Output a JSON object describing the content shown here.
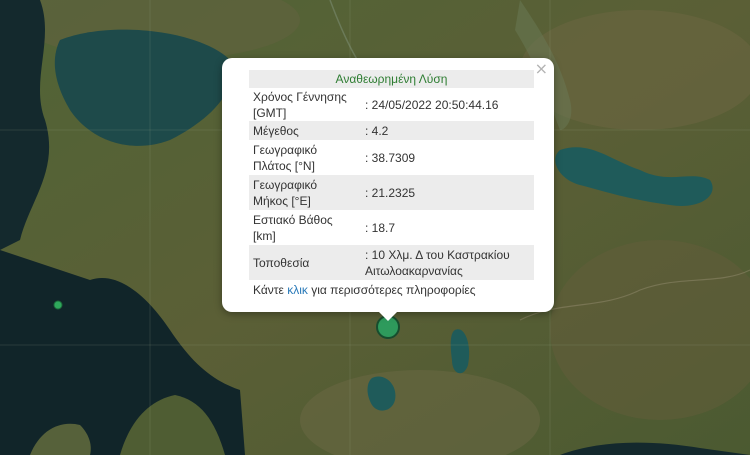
{
  "popup": {
    "title": "Αναθεωρημένη Λύση",
    "close_symbol": "×",
    "rows": [
      {
        "label": "Χρόνος Γέννησης [GMT]",
        "value": ": 24/05/2022 20:50:44.16"
      },
      {
        "label": "Μέγεθος",
        "value": ": 4.2"
      },
      {
        "label": "Γεωγραφικό Πλάτος [°N]",
        "value": ": 38.7309"
      },
      {
        "label": "Γεωγραφικό Μήκος [°E]",
        "value": ": 21.2325"
      },
      {
        "label": "Εστιακό Βάθος [km]",
        "value": ": 18.7"
      },
      {
        "label": "Τοποθεσία",
        "value": ": 10 Χλμ. Δ του Καστρακίου Αιτωλοακαρνανίας"
      }
    ],
    "footer_before": "Κάντε ",
    "footer_link": "κλικ",
    "footer_after": " για περισσότερες πληροφορίες"
  },
  "colors": {
    "marker_main": "#2e9a5c",
    "marker_small": "#2fa85c",
    "title_green": "#2e7d32",
    "link_blue": "#2a7ab9",
    "row_shade": "#ececec",
    "water": "#0f2a2e",
    "lake": "#1f5b5a",
    "land": "#4a5a30"
  }
}
